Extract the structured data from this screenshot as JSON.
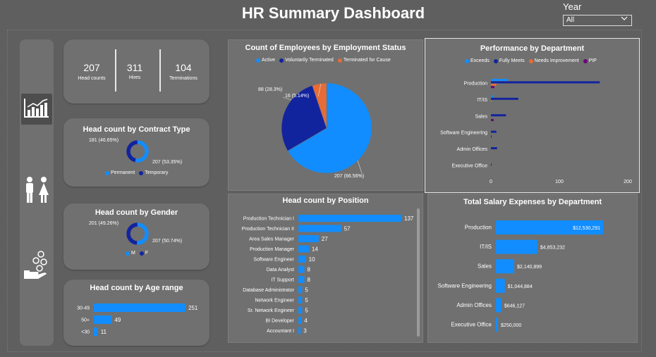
{
  "page_title": "HR Summary Dashboard",
  "year_filter": {
    "label": "Year",
    "selected": "All"
  },
  "nav": [
    {
      "icon": "chart-icon"
    },
    {
      "icon": "people-icon"
    },
    {
      "icon": "salary-icon"
    }
  ],
  "kpis": [
    {
      "value": "207",
      "label": "Head counts"
    },
    {
      "value": "311",
      "label": "Hires"
    },
    {
      "value": "104",
      "label": "Terminations"
    }
  ],
  "colors": {
    "blue": "#118dff",
    "navy": "#12239e",
    "orange": "#e66c37",
    "purple": "#6b007b",
    "card": "#707070",
    "background": "#5f5f5f"
  },
  "chart_data": [
    {
      "id": "contract",
      "type": "pie",
      "title": "Head count by Contract Type",
      "categories": [
        "Permanent",
        "Temporary"
      ],
      "values": [
        207,
        181
      ],
      "data_labels": [
        "207 (53.35%)",
        "181 (46.65%)"
      ]
    },
    {
      "id": "gender",
      "type": "pie",
      "title": "Head count by Gender",
      "categories": [
        "M",
        "F"
      ],
      "values": [
        207,
        201
      ],
      "data_labels": [
        "207 (50.74%)",
        "201 (49.26%)"
      ]
    },
    {
      "id": "age",
      "type": "bar",
      "title": "Head count by Age range",
      "categories": [
        "30-49",
        "50+",
        "<30"
      ],
      "values": [
        251,
        49,
        11
      ]
    },
    {
      "id": "status",
      "type": "pie",
      "title": "Count of Employees by Employment Status",
      "categories": [
        "Active",
        "Voluntarily Terminated",
        "Terminated for Cause"
      ],
      "values": [
        207,
        88,
        16
      ],
      "data_labels": [
        "207 (66.56%)",
        "88 (28.3%)",
        "16 (5.14%)"
      ]
    },
    {
      "id": "position",
      "type": "bar",
      "title": "Head count by Position",
      "categories": [
        "Production Technician I",
        "Production Technician II",
        "Area Sales Manager",
        "Production Manager",
        "Software Engineer",
        "Data Analyst",
        "IT Support",
        "Database Administrator",
        "Network Engineer",
        "Sr. Network Engineer",
        "BI Developer",
        "Accountant I"
      ],
      "values": [
        137,
        57,
        27,
        14,
        10,
        8,
        8,
        5,
        5,
        5,
        4,
        3
      ]
    },
    {
      "id": "performance",
      "type": "bar",
      "title": "Performance by Department",
      "categories": [
        "Production",
        "IT/IS",
        "Sales",
        "Software Engineering",
        "Admin Offices",
        "Executive Office"
      ],
      "series": [
        {
          "name": "Exceeds",
          "values": [
            25,
            4,
            0,
            0,
            0,
            0
          ]
        },
        {
          "name": "Fully Meets",
          "values": [
            159,
            40,
            22,
            8,
            9,
            1
          ]
        },
        {
          "name": "Needs Improvement",
          "values": [
            8,
            1,
            0,
            0,
            0,
            0
          ]
        },
        {
          "name": "PIP",
          "values": [
            5,
            0,
            4,
            1,
            0,
            0
          ]
        }
      ],
      "xlim": [
        0,
        200
      ],
      "xticks": [
        "0",
        "100",
        "200"
      ]
    },
    {
      "id": "salary",
      "type": "bar",
      "title": "Total Salary Expenses by Department",
      "categories": [
        "Production",
        "IT/IS",
        "Sales",
        "Software Engineering",
        "Admin Offices",
        "Executive Office"
      ],
      "values": [
        12530291,
        4853232,
        2140899,
        1044884,
        646127,
        250000
      ],
      "data_labels": [
        "$12,530,291",
        "$4,853,232",
        "$2,140,899",
        "$1,044,884",
        "$646,127",
        "$250,000"
      ]
    }
  ]
}
